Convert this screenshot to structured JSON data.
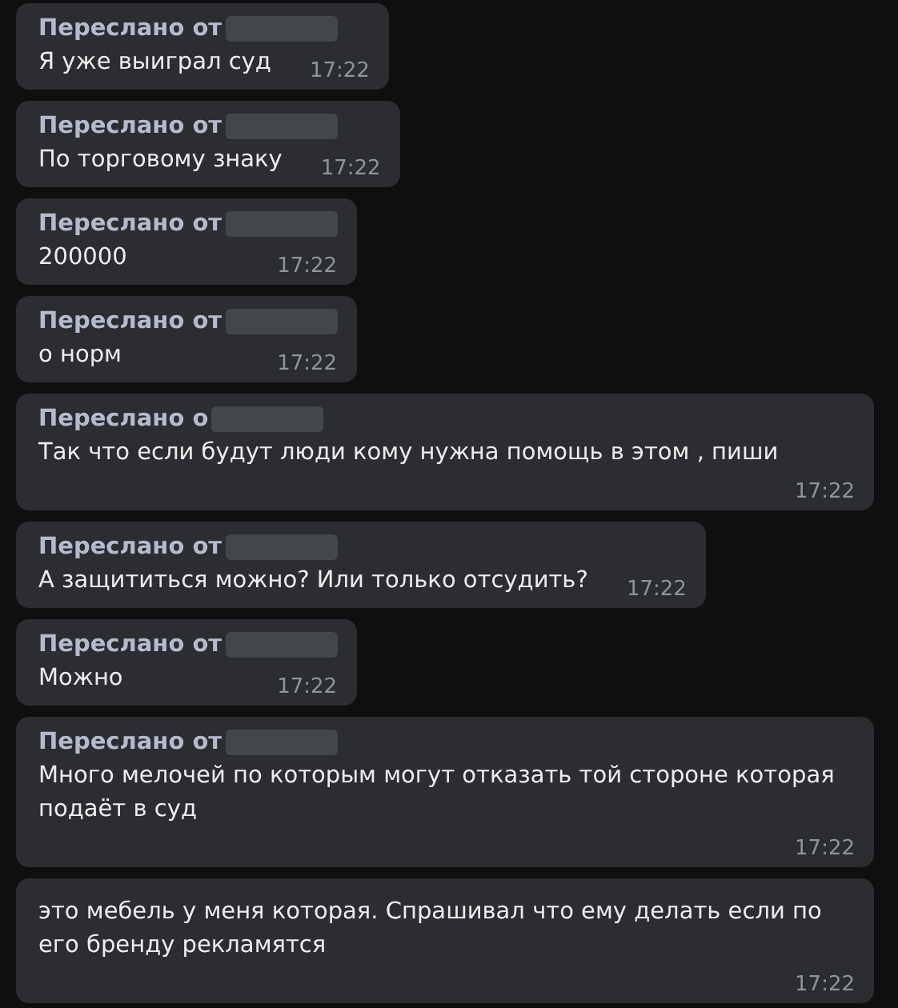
{
  "messages": [
    {
      "forwarded_label": "Переслано от",
      "text": "Я уже выиграл суд",
      "time": "17:22"
    },
    {
      "forwarded_label": "Переслано от",
      "text": "По торговому знаку",
      "time": "17:22"
    },
    {
      "forwarded_label": "Переслано от",
      "text": "200000",
      "time": "17:22"
    },
    {
      "forwarded_label": "Переслано от",
      "text": "о норм",
      "time": "17:22"
    },
    {
      "forwarded_label": "Переслано о",
      "text": "Так что если будут люди кому нужна помощь в этом , пиши",
      "time": "17:22"
    },
    {
      "forwarded_label": "Переслано от",
      "text": "А защититься можно? Или только отсудить?",
      "time": "17:22"
    },
    {
      "forwarded_label": "Переслано от",
      "text": "Можно",
      "time": "17:22"
    },
    {
      "forwarded_label": "Переслано от",
      "text": "Много мелочей по которым могут отказать той стороне которая подаёт в суд",
      "time": "17:22"
    },
    {
      "text": "это мебель у меня которая. Спрашивал что ему делать если по его бренду рекламятся",
      "time": "17:22"
    }
  ]
}
